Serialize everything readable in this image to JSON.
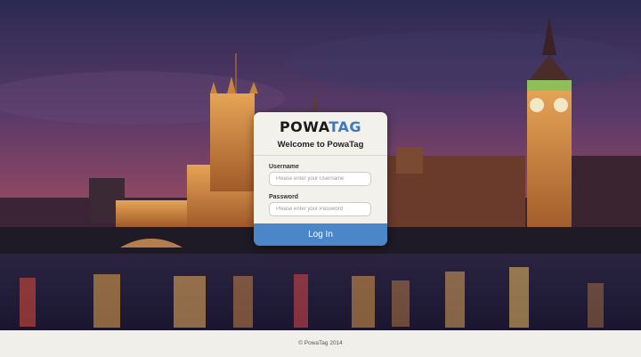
{
  "brand": {
    "logo_dark": "POWA",
    "logo_blue": "TAG"
  },
  "login": {
    "welcome": "Welcome to PowaTag",
    "username_label": "Username",
    "username_placeholder": "Please enter your Username",
    "password_label": "Password",
    "password_placeholder": "Please enter your Password",
    "submit_label": "Log In"
  },
  "footer": {
    "copyright": "© PowaTag 2014"
  },
  "colors": {
    "accent": "#4a86c8",
    "logo_blue": "#3f78c0",
    "card_bg": "#f3f1ec",
    "footer_bg": "#f1efe9"
  }
}
